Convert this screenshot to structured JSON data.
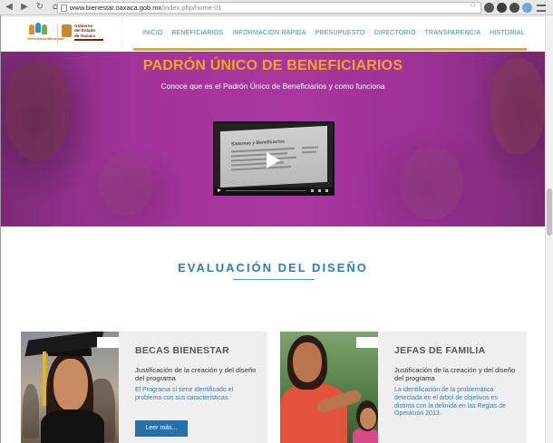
{
  "browser": {
    "url_host": "www.bienestar.oaxaca.gob.mx",
    "url_path": "/index.php/home-01"
  },
  "header": {
    "logo1_label": "Generando Bienestar",
    "logo2_text": [
      "Gobierno",
      "del Estado",
      "de Oaxaca"
    ],
    "nav": [
      {
        "label": "INICIO"
      },
      {
        "label": "BENEFICIARIOS"
      },
      {
        "label": "INFORMACIÓN RÁPIDA"
      },
      {
        "label": "PRESUPUESTO"
      },
      {
        "label": "DIRECTORIO"
      },
      {
        "label": "TRANSPARENCIA"
      },
      {
        "label": "HISTORIAL"
      }
    ]
  },
  "hero": {
    "title": "PADRÓN ÚNICO DE BENEFICIARIOS",
    "subtitle": "Conoce que es el Padrón Único de Beneficiarios y como funciona",
    "video_heading": "Sistemas y Beneficiarios"
  },
  "section": {
    "title": "EVALUACIÓN DEL DISEÑO"
  },
  "cards": [
    {
      "title": "BECAS BIENESTAR",
      "subtitle": "Justificación de la creación y del diseño del programa",
      "description": "El Programa sí tiene identificado el problema con sus características.",
      "button": "Leer más..."
    },
    {
      "title": "JEFAS DE FAMILIA",
      "subtitle": "Justificación de la creación y del diseño del programa",
      "description": "La identificación de la problemática detectada en el árbol de objetivos es distinta con la delinida en las Reglas de Operación 2013."
    }
  ],
  "colors": {
    "accent_orange": "#f4a51f",
    "hero_purple": "#a3349b",
    "link_blue": "#2f7fb5",
    "button_blue": "#2770a8"
  }
}
